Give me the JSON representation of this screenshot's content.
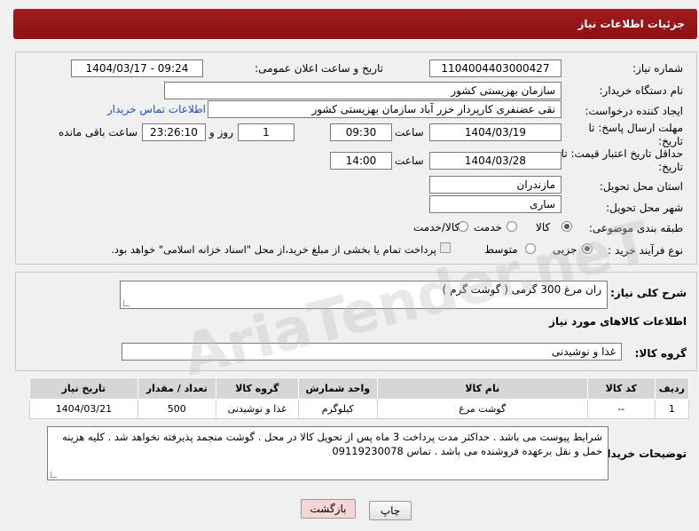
{
  "header": {
    "title": "جزئیات اطلاعات نیاز"
  },
  "form": {
    "need_number_label": "شماره نیاز:",
    "need_number": "1104004403000427",
    "announce_label": "تاریخ و ساعت اعلان عمومی:",
    "announce_value": "1404/03/17 - 09:24",
    "buyer_org_label": "نام دستگاه خریدار:",
    "buyer_org": "سازمان بهزیستی کشور",
    "creator_label": "ایجاد کننده درخواست:",
    "creator": "نقی عضنفری کارپرداز خزر آباد سازمان بهزیستی کشور",
    "contact_link": "اطلاعات تماس خریدار",
    "deadline_label": "مهلت ارسال پاسخ: تا تاریخ:",
    "deadline_date": "1404/03/19",
    "time_label": "ساعت",
    "deadline_time": "09:30",
    "days_value": "1",
    "days_label": "روز و",
    "remaining_value": "23:26:10",
    "remaining_label": "ساعت باقی مانده",
    "validity_label": "حداقل تاریخ اعتبار قیمت: تا تاریخ:",
    "validity_date": "1404/03/28",
    "validity_time": "14:00",
    "province_label": "استان محل تحویل:",
    "province": "مازندران",
    "city_label": "شهر محل تحویل:",
    "city": "ساری",
    "category_label": "طبقه بندی موضوعی:",
    "category_options": [
      "کالا",
      "خدمت",
      "کالا/خدمت"
    ],
    "process_label": "نوع فرآیند خرید :",
    "process_options": [
      "جزیی",
      "متوسط"
    ],
    "payment_note": "پرداخت تمام یا بخشی از مبلغ خرید،از محل \"اسناد خزانه اسلامی\" خواهد بود."
  },
  "summary": {
    "label": "شرح کلی نیاز:",
    "value": "ران مرغ 300 گرمی ( گوشت گرم )"
  },
  "goods": {
    "section_title": "اطلاعات کالاهای مورد نیاز",
    "group_label": "گروه کالا:",
    "group_value": "غذا و نوشیدنی",
    "columns": [
      "ردیف",
      "کد کالا",
      "نام کالا",
      "واحد شمارش",
      "گروه کالا",
      "تعداد / مقدار",
      "تاریخ نیاز"
    ],
    "rows": [
      {
        "row": "1",
        "code": "--",
        "name": "گوشت مرغ",
        "unit": "کیلوگرم",
        "group": "غذا و نوشیدنی",
        "qty": "500",
        "date": "1404/03/21"
      }
    ]
  },
  "buyer_notes": {
    "label": "توضیحات خریدار:",
    "text": "شرایط پیوست می باشد . حداکثر مدت پرداخت 3 ماه پس از تحویل کالا در محل . گوشت منجمد پذیرفته نخواهد شد . کلیه هزینه حمل و نقل برعهده فروشنده می باشد . تماس 09119230078"
  },
  "buttons": {
    "print": "چاپ",
    "back": "بازگشت"
  },
  "watermark": "AriaTender.neT",
  "colors": {
    "header": "#8d1013",
    "link": "#1a52c9",
    "back_button": "#f6d6d6"
  }
}
